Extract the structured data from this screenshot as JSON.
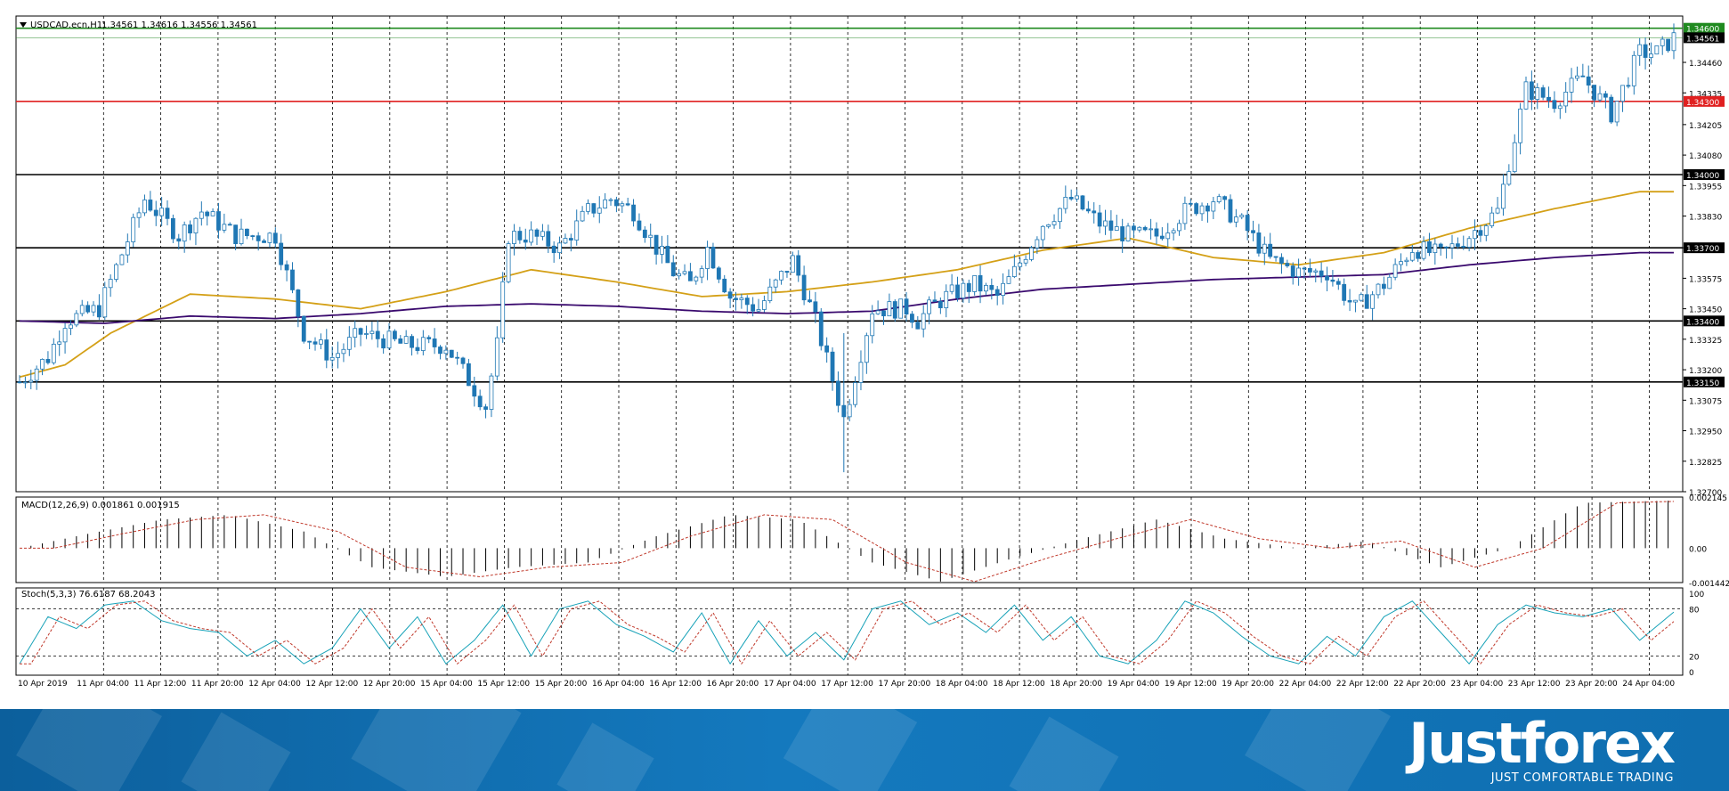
{
  "chart_header": {
    "symbol_text": "USDCAD.ecn,H1",
    "ohlc_text": "1.34561 1.34616 1.34556 1.34561"
  },
  "macd_header": {
    "text": "MACD(12,26,9) 0.001861 0.001915"
  },
  "stoch_header": {
    "text": "Stoch(5,3,3) 76.6187 68.2043"
  },
  "chart_data": [
    {
      "type": "candlestick",
      "title": "USDCAD.ecn,H1",
      "timeframe": "H1",
      "ohlc_last": {
        "open": 1.34561,
        "high": 1.34616,
        "low": 1.34556,
        "close": 1.34561
      },
      "ylim": [
        1.327,
        1.3465
      ],
      "y_ticks": [
        "1.34460",
        "1.34335",
        "1.34205",
        "1.34080",
        "1.33955",
        "1.33830",
        "1.33700",
        "1.33575",
        "1.33450",
        "1.33325",
        "1.33200",
        "1.33075",
        "1.32950",
        "1.32825",
        "1.32700"
      ],
      "x_ticks": [
        "10 Apr 2019",
        "11 Apr 04:00",
        "11 Apr 12:00",
        "11 Apr 20:00",
        "12 Apr 04:00",
        "12 Apr 12:00",
        "12 Apr 20:00",
        "15 Apr 04:00",
        "15 Apr 12:00",
        "15 Apr 20:00",
        "16 Apr 04:00",
        "16 Apr 12:00",
        "16 Apr 20:00",
        "17 Apr 04:00",
        "17 Apr 12:00",
        "17 Apr 20:00",
        "18 Apr 04:00",
        "18 Apr 12:00",
        "18 Apr 20:00",
        "19 Apr 04:00",
        "19 Apr 12:00",
        "19 Apr 20:00",
        "22 Apr 04:00",
        "22 Apr 12:00",
        "22 Apr 20:00",
        "23 Apr 04:00",
        "23 Apr 12:00",
        "23 Apr 20:00",
        "24 Apr 04:00"
      ],
      "grid": "dashed vertical",
      "levels": [
        {
          "value": "1.34600",
          "color": "#1f8a1f"
        },
        {
          "value": "1.34561",
          "color": "#000000"
        },
        {
          "value": "1.34300",
          "color": "#e02020"
        },
        {
          "value": "1.34000",
          "color": "#000000"
        },
        {
          "value": "1.33700",
          "color": "#000000"
        },
        {
          "value": "1.33400",
          "color": "#000000"
        },
        {
          "value": "1.33150",
          "color": "#000000"
        }
      ],
      "candle_color": "#1f77b4",
      "moving_averages": [
        {
          "color": "#d4a017",
          "x": [
            0,
            8,
            16,
            30,
            45,
            60,
            75,
            90,
            105,
            120,
            135,
            150,
            165,
            180,
            195,
            210,
            225,
            240,
            255,
            270,
            285
          ],
          "values": [
            1.3317,
            1.3322,
            1.3335,
            1.3351,
            1.3349,
            1.3345,
            1.3352,
            1.3361,
            1.3356,
            1.335,
            1.3352,
            1.3356,
            1.3361,
            1.3369,
            1.3374,
            1.3366,
            1.3363,
            1.3368,
            1.3378,
            1.3386,
            1.3393
          ]
        },
        {
          "color": "#3a0a6e",
          "x": [
            0,
            15,
            30,
            45,
            60,
            75,
            90,
            105,
            120,
            135,
            150,
            165,
            180,
            195,
            210,
            225,
            240,
            255,
            270,
            285
          ],
          "values": [
            1.334,
            1.3339,
            1.3342,
            1.3341,
            1.3343,
            1.3346,
            1.3347,
            1.3346,
            1.3344,
            1.3343,
            1.3344,
            1.3349,
            1.3353,
            1.3355,
            1.3357,
            1.3358,
            1.3359,
            1.3363,
            1.3366,
            1.3368
          ]
        }
      ],
      "price_path": {
        "x": [
          0,
          5,
          8,
          14,
          22,
          28,
          32,
          38,
          45,
          50,
          55,
          60,
          68,
          75,
          82,
          84,
          86,
          90,
          95,
          100,
          104,
          108,
          112,
          115,
          118,
          121,
          125,
          130,
          136,
          140,
          145,
          150,
          156,
          158,
          160,
          163,
          168,
          172,
          175,
          180,
          185,
          190,
          195,
          200,
          205,
          210,
          215,
          220,
          225,
          230,
          235,
          240,
          245,
          250,
          255,
          260,
          265,
          270,
          275,
          280,
          285,
          288,
          291
        ],
        "values": [
          1.3315,
          1.3325,
          1.334,
          1.3345,
          1.339,
          1.3375,
          1.3385,
          1.3375,
          1.3375,
          1.3335,
          1.3325,
          1.3335,
          1.333,
          1.333,
          1.3305,
          1.333,
          1.3375,
          1.3375,
          1.337,
          1.3385,
          1.339,
          1.3385,
          1.337,
          1.336,
          1.3355,
          1.337,
          1.335,
          1.3345,
          1.3365,
          1.334,
          1.33,
          1.3345,
          1.3345,
          1.334,
          1.3345,
          1.335,
          1.3355,
          1.335,
          1.336,
          1.338,
          1.339,
          1.338,
          1.3375,
          1.3375,
          1.3385,
          1.339,
          1.338,
          1.3365,
          1.336,
          1.336,
          1.3345,
          1.3355,
          1.337,
          1.3367,
          1.3375,
          1.3385,
          1.3435,
          1.343,
          1.344,
          1.3425,
          1.345,
          1.345,
          1.3456
        ]
      },
      "spikes": [
        {
          "x": 145,
          "low": 1.3278,
          "high": 1.3335
        }
      ]
    },
    {
      "type": "bar",
      "title": "MACD(12,26,9)",
      "ylim": [
        -0.001442,
        0.002145
      ],
      "y_ticks": [
        "0.002145",
        "0.00",
        "-0.001442"
      ],
      "bar_color": "#000000",
      "signal_color": "#c0392b",
      "x": [
        0,
        12,
        25,
        37,
        50,
        62,
        75,
        87,
        100,
        112,
        125,
        137,
        150,
        162,
        175,
        187,
        200,
        212,
        225,
        237,
        250,
        262,
        275,
        291
      ],
      "values": [
        0.0,
        0.0006,
        0.0012,
        0.0014,
        0.0007,
        -0.0008,
        -0.0012,
        -0.0008,
        -0.0006,
        0.0005,
        0.0014,
        0.0012,
        -0.0006,
        -0.0014,
        -0.0004,
        0.0004,
        0.0012,
        0.0004,
        0.0,
        0.0003,
        -0.0008,
        0.0,
        0.0019,
        0.002
      ]
    },
    {
      "type": "line",
      "title": "Stoch(5,3,3)",
      "ylim": [
        0,
        100
      ],
      "y_ticks": [
        "100",
        "80",
        "20",
        "0"
      ],
      "levels": [
        80,
        20
      ],
      "main_color": "#17a2b8",
      "signal_color": "#c0392b",
      "x": [
        0,
        5,
        10,
        15,
        20,
        25,
        30,
        35,
        40,
        45,
        50,
        55,
        60,
        65,
        70,
        75,
        80,
        85,
        90,
        95,
        100,
        105,
        110,
        115,
        120,
        125,
        130,
        135,
        140,
        145,
        150,
        155,
        160,
        165,
        170,
        175,
        180,
        185,
        190,
        195,
        200,
        205,
        210,
        215,
        220,
        225,
        230,
        235,
        240,
        245,
        250,
        255,
        260,
        265,
        270,
        275,
        280,
        285,
        291
      ],
      "values": [
        10,
        70,
        55,
        85,
        90,
        65,
        55,
        50,
        20,
        40,
        10,
        30,
        80,
        30,
        70,
        10,
        40,
        85,
        20,
        80,
        90,
        60,
        45,
        25,
        75,
        10,
        65,
        20,
        50,
        15,
        80,
        90,
        60,
        75,
        50,
        85,
        40,
        70,
        20,
        10,
        40,
        90,
        75,
        45,
        20,
        10,
        45,
        20,
        70,
        90,
        50,
        10,
        60,
        85,
        75,
        70,
        80,
        40,
        76
      ]
    }
  ],
  "brand": {
    "logo_text": "Justforex",
    "tagline": "JUST COMFORTABLE TRADING",
    "banner_color": "#0f6eb0"
  }
}
